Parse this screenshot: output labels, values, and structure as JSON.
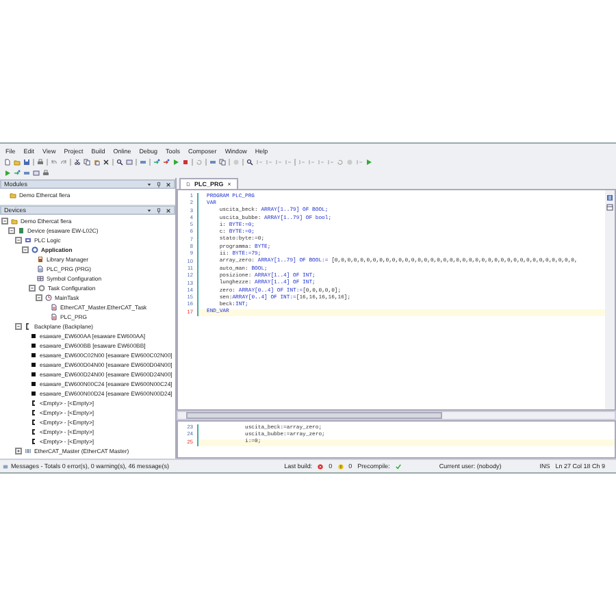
{
  "menu": [
    "File",
    "Edit",
    "View",
    "Project",
    "Build",
    "Online",
    "Debug",
    "Tools",
    "Composer",
    "Window",
    "Help"
  ],
  "modules_panel": {
    "title": "Modules",
    "tree": [
      {
        "label": "Demo Ethercat fiera",
        "kind": "project",
        "active": false
      }
    ]
  },
  "devices_panel": {
    "title": "Devices",
    "tree": [
      {
        "label": "Demo Ethercat fiera",
        "kind": "project",
        "active": false,
        "expanded": true,
        "children": [
          {
            "label": "Device (esaware EW-L02C)",
            "kind": "device",
            "active": false,
            "expanded": true,
            "children": [
              {
                "label": "PLC Logic",
                "kind": "plc",
                "active": false,
                "expanded": true,
                "children": [
                  {
                    "label": "Application",
                    "kind": "application",
                    "active": true,
                    "expanded": true,
                    "children": [
                      {
                        "label": "Library Manager",
                        "kind": "library",
                        "active": false
                      },
                      {
                        "label": "PLC_PRG (PRG)",
                        "kind": "program",
                        "active": false
                      },
                      {
                        "label": "Symbol Configuration",
                        "kind": "symbols",
                        "active": false
                      },
                      {
                        "label": "Task Configuration",
                        "kind": "tasks",
                        "active": false,
                        "expanded": true,
                        "children": [
                          {
                            "label": "MainTask",
                            "kind": "task",
                            "active": false,
                            "expanded": true,
                            "children": [
                              {
                                "label": "EtherCAT_Master.EtherCAT_Task",
                                "kind": "call",
                                "active": false
                              },
                              {
                                "label": "PLC_PRG",
                                "kind": "call",
                                "active": false
                              }
                            ]
                          }
                        ]
                      }
                    ]
                  }
                ]
              },
              {
                "label": "Backplane (Backplane)",
                "kind": "backplane",
                "active": false,
                "expanded": true,
                "children": [
                  {
                    "label": "esaware_EW600AA [esaware EW600AA]",
                    "kind": "module",
                    "active": false
                  },
                  {
                    "label": "esaware_EW600BB [esaware EW600BB]",
                    "kind": "module",
                    "active": false
                  },
                  {
                    "label": "esaware_EW600C02N00 [esaware EW600C02N00]",
                    "kind": "module",
                    "active": false
                  },
                  {
                    "label": "esaware_EW600D04N00 [esaware EW600D04N00]",
                    "kind": "module",
                    "active": false
                  },
                  {
                    "label": "esaware_EW600D24N00 [esaware EW600D24N00]",
                    "kind": "module",
                    "active": false
                  },
                  {
                    "label": "esaware_EW600N00C24 [esaware EW600N00C24]",
                    "kind": "module",
                    "active": false
                  },
                  {
                    "label": "esaware_EW600N00D24 [esaware EW600N00D24]",
                    "kind": "module",
                    "active": false
                  },
                  {
                    "label": "<Empty> - [<Empty>]",
                    "kind": "empty",
                    "active": false
                  },
                  {
                    "label": "<Empty> - [<Empty>]",
                    "kind": "empty",
                    "active": false
                  },
                  {
                    "label": "<Empty> - [<Empty>]",
                    "kind": "empty",
                    "active": false
                  },
                  {
                    "label": "<Empty> - [<Empty>]",
                    "kind": "empty",
                    "active": false
                  },
                  {
                    "label": "<Empty> - [<Empty>]",
                    "kind": "empty",
                    "active": false
                  }
                ]
              },
              {
                "label": "EtherCAT_Master (EtherCAT Master)",
                "kind": "master",
                "active": false,
                "expanded": false
              }
            ]
          }
        ]
      }
    ]
  },
  "editor": {
    "tab": {
      "label": "PLC_PRG",
      "selected": true
    },
    "declarations": [
      {
        "number": "1",
        "current": false,
        "parts": [
          {
            "text": "PROGRAM PLC_PRG",
            "kind": "keyword"
          }
        ]
      },
      {
        "number": "2",
        "current": false,
        "parts": [
          {
            "text": "VAR",
            "kind": "keyword"
          }
        ]
      },
      {
        "number": "3",
        "current": false,
        "parts": [
          {
            "text": "    uscita_beck: ",
            "kind": "plain"
          },
          {
            "text": "ARRAY[1..79] OF BOOL;",
            "kind": "keyword"
          }
        ]
      },
      {
        "number": "4",
        "current": false,
        "parts": [
          {
            "text": "    uscita_bubbe: ",
            "kind": "plain"
          },
          {
            "text": "ARRAY[1..79] OF bool;",
            "kind": "keyword"
          }
        ]
      },
      {
        "number": "5",
        "current": false,
        "parts": [
          {
            "text": "    i: ",
            "kind": "plain"
          },
          {
            "text": "BYTE:=0;",
            "kind": "keyword"
          }
        ]
      },
      {
        "number": "6",
        "current": false,
        "parts": [
          {
            "text": "    c: ",
            "kind": "plain"
          },
          {
            "text": "BYTE:=0;",
            "kind": "keyword"
          }
        ]
      },
      {
        "number": "7",
        "current": false,
        "parts": [
          {
            "text": "    stato:byte:=0;",
            "kind": "plain"
          }
        ]
      },
      {
        "number": "8",
        "current": false,
        "parts": [
          {
            "text": "    programma: ",
            "kind": "plain"
          },
          {
            "text": "BYTE;",
            "kind": "keyword"
          }
        ]
      },
      {
        "number": "9",
        "current": false,
        "parts": [
          {
            "text": "    ii: ",
            "kind": "plain"
          },
          {
            "text": "BYTE:=79;",
            "kind": "keyword"
          }
        ]
      },
      {
        "number": "10",
        "current": false,
        "parts": [
          {
            "text": "    array_zero: ",
            "kind": "plain"
          },
          {
            "text": "ARRAY[1..79] OF BOOL:= ",
            "kind": "keyword"
          },
          {
            "text": "[0,0,0,0,0,0,0,0,0,0,0,0,0,0,0,0,0,0,0,0,0,0,0,0,0,0,0,0,0,0,0,0,0,0,0,0,0,0,",
            "kind": "plain"
          }
        ]
      },
      {
        "number": "11",
        "current": false,
        "parts": [
          {
            "text": "    auto_man: ",
            "kind": "plain"
          },
          {
            "text": "BOOL;",
            "kind": "keyword"
          }
        ]
      },
      {
        "number": "12",
        "current": false,
        "parts": [
          {
            "text": "    posizione: ",
            "kind": "plain"
          },
          {
            "text": "ARRAY[1..4] OF INT;",
            "kind": "keyword"
          }
        ]
      },
      {
        "number": "13",
        "current": false,
        "parts": [
          {
            "text": "    lunghezze: ",
            "kind": "plain"
          },
          {
            "text": "ARRAY[1..4] OF INT;",
            "kind": "keyword"
          }
        ]
      },
      {
        "number": "14",
        "current": false,
        "parts": [
          {
            "text": "    zero: ",
            "kind": "plain"
          },
          {
            "text": "ARRAY[0..4] OF INT:=",
            "kind": "keyword"
          },
          {
            "text": "[0,0,0,0,0];",
            "kind": "plain"
          }
        ]
      },
      {
        "number": "15",
        "current": false,
        "parts": [
          {
            "text": "    sen:",
            "kind": "plain"
          },
          {
            "text": "ARRAY[0..4] OF INT:=",
            "kind": "keyword"
          },
          {
            "text": "[16,16,16,16,16];",
            "kind": "plain"
          }
        ]
      },
      {
        "number": "16",
        "current": false,
        "parts": [
          {
            "text": "    beck:",
            "kind": "plain"
          },
          {
            "text": "INT;",
            "kind": "keyword"
          }
        ]
      },
      {
        "number": "17",
        "current": true,
        "parts": [
          {
            "text": "END_VAR",
            "kind": "keyword"
          }
        ]
      }
    ],
    "body": [
      {
        "number": "23",
        "current": false,
        "parts": [
          {
            "text": "            uscita_beck:=array_zero;"
          }
        ]
      },
      {
        "number": "24",
        "current": false,
        "parts": [
          {
            "text": "            uscita_bubbe:=array_zero;"
          }
        ]
      },
      {
        "number": "25",
        "current": true,
        "parts": [
          {
            "text": "            i:=0;"
          }
        ]
      }
    ]
  },
  "messages_tab": "Messages - Totals 0 error(s), 0 warning(s), 46 message(s)",
  "status_bar": {
    "last_build": "Last build:",
    "errors": "0",
    "warnings": "0",
    "precompile": "Precompile:",
    "precompile_ok": true,
    "user": "Current user: (nobody)",
    "mode": "INS",
    "position": "Ln 27   Col 18   Ch 9"
  }
}
